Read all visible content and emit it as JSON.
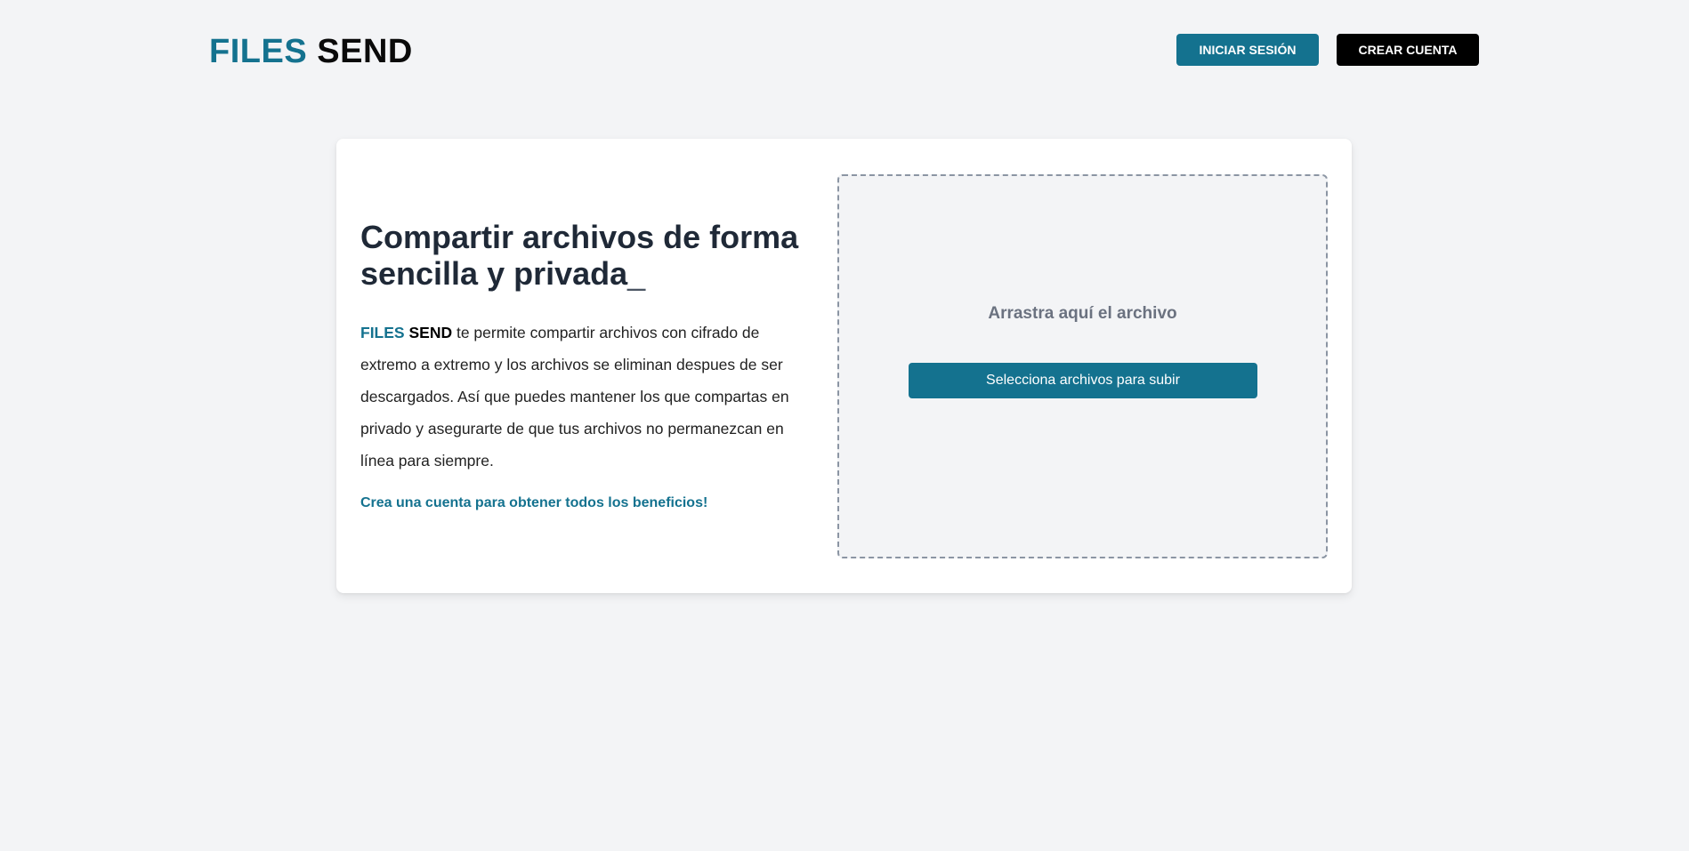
{
  "header": {
    "logo_part1": "FILES",
    "logo_part2": "SEND",
    "login_label": "INICIAR SESIÓN",
    "register_label": "CREAR CUENTA"
  },
  "hero": {
    "title": "Compartir archivos de forma sencilla y privada",
    "cursor": "_",
    "brand_part1": "FILES",
    "brand_part2": "SEND",
    "description": " te permite compartir archivos con cifrado de extremo a extremo y los archivos se eliminan despues de ser descargados. Así que puedes mantener los que compartas en privado y asegurarte de que tus archivos no permanezcan en línea para siempre.",
    "cta": "Crea una cuenta para obtener todos los beneficios!"
  },
  "upload": {
    "drop_label": "Arrastra aquí el archivo",
    "select_label": "Selecciona archivos para subir"
  },
  "colors": {
    "accent": "#14728f",
    "dark": "#000000",
    "background": "#f3f4f6"
  }
}
